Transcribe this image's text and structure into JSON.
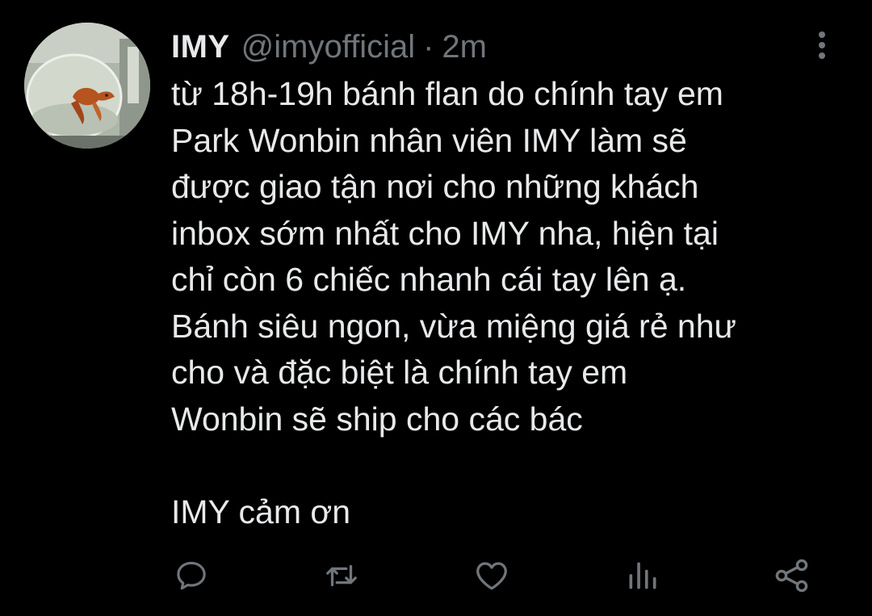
{
  "tweet": {
    "display_name": "IMY",
    "handle": "@imyofficial",
    "separator": "·",
    "time": "2m",
    "lines_paragraph_1": [
      "từ 18h-19h bánh flan do chính tay em",
      "Park Wonbin nhân viên IMY làm sẽ",
      "được giao tận nơi cho những khách",
      "inbox sớm nhất cho IMY nha, hiện tại",
      "chỉ còn 6 chiếc nhanh cái tay lên ạ.",
      "Bánh siêu ngon, vừa miệng giá rẻ như",
      "cho và đặc biệt là chính tay em",
      "Wonbin sẽ ship cho các bác"
    ],
    "lines_paragraph_2": [
      "IMY cảm ơn"
    ]
  },
  "icons": {
    "more": "more-vertical-icon",
    "reply": "reply-icon",
    "retweet": "retweet-icon",
    "like": "heart-icon",
    "analytics": "analytics-icon",
    "share": "share-icon"
  },
  "colors": {
    "background": "#000000",
    "text_primary": "#e7e9ea",
    "text_secondary": "#71767b"
  }
}
